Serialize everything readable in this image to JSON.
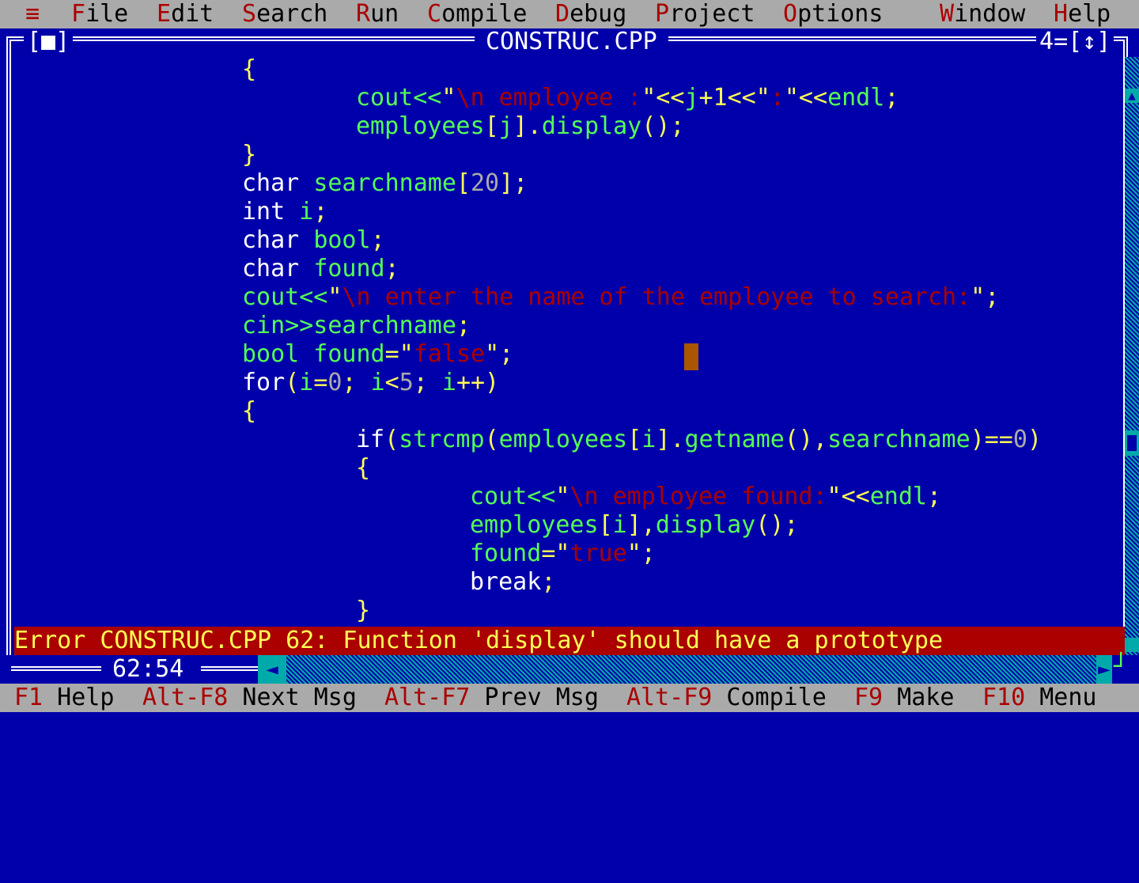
{
  "menu": {
    "system": "≡",
    "items": [
      {
        "hot": "F",
        "rest": "ile"
      },
      {
        "hot": "E",
        "rest": "dit"
      },
      {
        "hot": "S",
        "rest": "earch"
      },
      {
        "hot": "R",
        "rest": "un"
      },
      {
        "hot": "C",
        "rest": "ompile"
      },
      {
        "hot": "D",
        "rest": "ebug"
      },
      {
        "hot": "P",
        "rest": "roject"
      },
      {
        "hot": "O",
        "rest": "ptions"
      },
      {
        "hot": "W",
        "rest": "indow"
      },
      {
        "hot": "H",
        "rest": "elp"
      }
    ]
  },
  "window": {
    "title": "CONSTRUC.CPP",
    "number": "4",
    "close_box": "[■]",
    "zoom_box": "[↕]"
  },
  "code_lines": [
    [
      [
        "sym",
        "{"
      ]
    ],
    [
      [
        "id",
        "cout<<"
      ],
      [
        "sym",
        "\""
      ],
      [
        "str",
        "\\n employee :"
      ],
      [
        "sym",
        "\"<<"
      ],
      [
        "id",
        "j"
      ],
      [
        "sym",
        "+1<<"
      ],
      [
        "sym",
        "\""
      ],
      [
        "str",
        ":"
      ],
      [
        "sym",
        "\"<<"
      ],
      [
        "id",
        "endl"
      ],
      [
        "sym",
        ";"
      ]
    ],
    [
      [
        "id",
        "employees"
      ],
      [
        "sym",
        "["
      ],
      [
        "id",
        "j"
      ],
      [
        "sym",
        "]."
      ],
      [
        "id",
        "display"
      ],
      [
        "sym",
        "();"
      ]
    ],
    [
      [
        "sym",
        "}"
      ]
    ],
    [
      [
        "kw",
        "char "
      ],
      [
        "id",
        "searchname"
      ],
      [
        "sym",
        "["
      ],
      [
        "num",
        "20"
      ],
      [
        "sym",
        "];"
      ]
    ],
    [
      [
        "kw",
        "int "
      ],
      [
        "id",
        "i"
      ],
      [
        "sym",
        ";"
      ]
    ],
    [
      [
        "kw",
        "char "
      ],
      [
        "id",
        "bool"
      ],
      [
        "sym",
        ";"
      ]
    ],
    [
      [
        "kw",
        "char "
      ],
      [
        "id",
        "found"
      ],
      [
        "sym",
        ";"
      ]
    ],
    [
      [
        "id",
        "cout<<"
      ],
      [
        "sym",
        "\""
      ],
      [
        "str",
        "\\n enter the name of the employee to search:"
      ],
      [
        "sym",
        "\";"
      ]
    ],
    [
      [
        "id",
        "cin>>searchname"
      ],
      [
        "sym",
        ";"
      ]
    ],
    [
      [
        "id",
        "bool found"
      ],
      [
        "sym",
        "="
      ],
      [
        "sym",
        "\""
      ],
      [
        "str",
        "false"
      ],
      [
        "sym",
        "\";"
      ]
    ],
    [
      [
        "kw",
        "for"
      ],
      [
        "sym",
        "("
      ],
      [
        "id",
        "i"
      ],
      [
        "sym",
        "="
      ],
      [
        "num",
        "0"
      ],
      [
        "sym",
        "; "
      ],
      [
        "id",
        "i"
      ],
      [
        "sym",
        "<"
      ],
      [
        "num",
        "5"
      ],
      [
        "sym",
        "; "
      ],
      [
        "id",
        "i"
      ],
      [
        "sym",
        "++)"
      ]
    ],
    [
      [
        "sym",
        "{"
      ]
    ],
    [
      [
        "kw",
        "if"
      ],
      [
        "sym",
        "("
      ],
      [
        "id",
        "strcmp"
      ],
      [
        "sym",
        "("
      ],
      [
        "id",
        "employees"
      ],
      [
        "sym",
        "["
      ],
      [
        "id",
        "i"
      ],
      [
        "sym",
        "]."
      ],
      [
        "id",
        "getname"
      ],
      [
        "sym",
        "(),"
      ],
      [
        "id",
        "searchname"
      ],
      [
        "sym",
        ")=="
      ],
      [
        "num",
        "0"
      ],
      [
        "sym",
        ")"
      ]
    ],
    [
      [
        "sym",
        "{"
      ]
    ],
    [
      [
        "id",
        "cout<<"
      ],
      [
        "sym",
        "\""
      ],
      [
        "str",
        "\\n employee found:"
      ],
      [
        "sym",
        "\"<<"
      ],
      [
        "id",
        "endl"
      ],
      [
        "sym",
        ";"
      ]
    ],
    [
      [
        "id",
        "employees"
      ],
      [
        "sym",
        "["
      ],
      [
        "id",
        "i"
      ],
      [
        "sym",
        "],"
      ],
      [
        "id",
        "display"
      ],
      [
        "sym",
        "();"
      ]
    ],
    [
      [
        "id",
        "found"
      ],
      [
        "sym",
        "="
      ],
      [
        "sym",
        "\""
      ],
      [
        "str",
        "true"
      ],
      [
        "sym",
        "\";"
      ]
    ],
    [
      [
        "kw",
        "break"
      ],
      [
        "sym",
        ";"
      ]
    ],
    [
      [
        "sym",
        "}"
      ]
    ]
  ],
  "error_message": "Error CONSTRUC.CPP 62: Function 'display' should have a prototype",
  "cursor_position": "62:54",
  "function_keys": [
    {
      "key": "F1",
      "label": " Help"
    },
    {
      "key": "Alt-F8",
      "label": " Next Msg"
    },
    {
      "key": "Alt-F7",
      "label": " Prev Msg"
    },
    {
      "key": "Alt-F9",
      "label": " Compile"
    },
    {
      "key": "F9",
      "label": " Make"
    },
    {
      "key": "F10",
      "label": " Menu"
    }
  ]
}
